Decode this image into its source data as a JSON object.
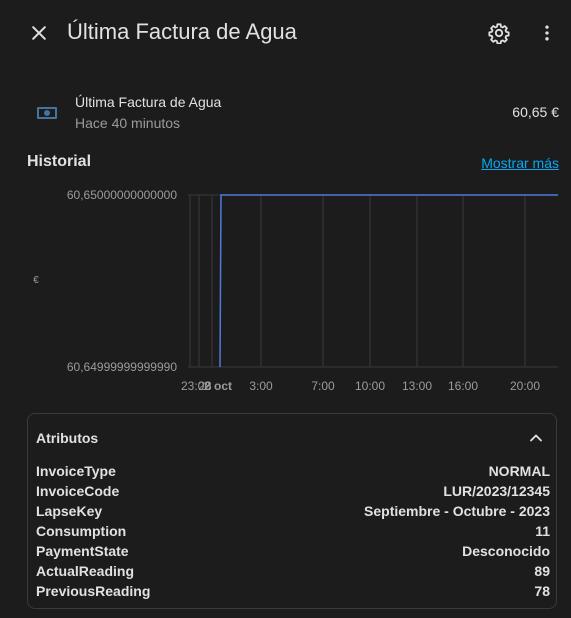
{
  "header": {
    "title": "Última Factura de Agua",
    "close_icon": "close-icon",
    "settings_icon": "gear-icon",
    "more_icon": "more-vertical-icon"
  },
  "entity": {
    "icon": "cash-icon",
    "name": "Última Factura de Agua",
    "last_changed": "Hace 40 minutos",
    "state": "60,65 €"
  },
  "history": {
    "title": "Historial",
    "show_more": "Mostrar más"
  },
  "chart_data": {
    "type": "line",
    "ylabel": "€",
    "ytick_labels": [
      "60,65000000000000",
      "60,64999999999990"
    ],
    "xtick_labels": [
      "23:00",
      "28",
      "2 oct",
      "3:00",
      "7:00",
      "10:00",
      "13:00",
      "16:00",
      "20:00"
    ],
    "series": [
      {
        "color": "#4f7bdb",
        "points": [
          {
            "t": "2 oct 00:00",
            "y": 60.6499999999999
          },
          {
            "t": "2 oct 00:10",
            "y": 60.65
          },
          {
            "t": "2 oct 23:59",
            "y": 60.65
          }
        ]
      }
    ]
  },
  "attributes": {
    "title": "Atributos",
    "chevron_icon": "chevron-up-icon",
    "items": [
      {
        "key": "InvoiceType",
        "value": "NORMAL"
      },
      {
        "key": "InvoiceCode",
        "value": "LUR/2023/12345"
      },
      {
        "key": "LapseKey",
        "value": "Septiembre - Octubre - 2023"
      },
      {
        "key": "Consumption",
        "value": "11"
      },
      {
        "key": "PaymentState",
        "value": "Desconocido"
      },
      {
        "key": "ActualReading",
        "value": "89"
      },
      {
        "key": "PreviousReading",
        "value": "78"
      }
    ]
  },
  "colors": {
    "background": "#1c1c1c",
    "accent_link": "#03a9f4",
    "line": "#4f7bdb"
  }
}
